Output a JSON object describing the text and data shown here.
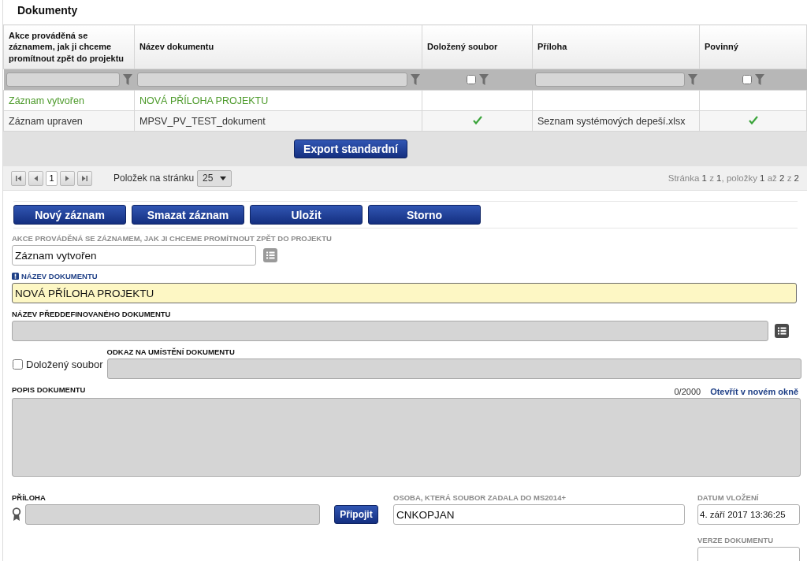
{
  "section_title": "Dokumenty",
  "table": {
    "columns": [
      "Akce prováděná se záznamem, jak ji chceme promítnout zpět do projektu",
      "Název dokumentu",
      "Doložený soubor",
      "Příloha",
      "Povinný"
    ],
    "filters": [
      {
        "kind": "text"
      },
      {
        "kind": "text"
      },
      {
        "kind": "checkbox",
        "checked": false
      },
      {
        "kind": "text"
      },
      {
        "kind": "checkbox",
        "checked": false
      }
    ],
    "rows": [
      {
        "new": true,
        "cells": [
          {
            "kind": "text",
            "text": "Záznam vytvořen"
          },
          {
            "kind": "text",
            "text": "NOVÁ PŘÍLOHA PROJEKTU"
          },
          {
            "kind": "check",
            "checked": false
          },
          {
            "kind": "text",
            "text": ""
          },
          {
            "kind": "check",
            "checked": false
          }
        ]
      },
      {
        "new": false,
        "cells": [
          {
            "kind": "text",
            "text": "Záznam upraven"
          },
          {
            "kind": "text",
            "text": "MPSV_PV_TEST_dokument"
          },
          {
            "kind": "check",
            "checked": true
          },
          {
            "kind": "text",
            "text": "Seznam systémových depeší.xlsx"
          },
          {
            "kind": "check",
            "checked": true
          }
        ]
      }
    ]
  },
  "export_button": "Export standardní",
  "pager": {
    "page": "1",
    "page_size_label": "Položek na stránku",
    "page_size": "25",
    "summary": "Stránka **1** z **1**, položky **1** až **2** z **2**"
  },
  "actions": [
    "Nový záznam",
    "Smazat záznam",
    "Uložit",
    "Storno"
  ],
  "form": {
    "action": {
      "label": "AKCE PROVÁDĚNÁ SE ZÁZNAMEM, JAK JI CHCEME PROMÍTNOUT ZPĚT DO PROJEKTU",
      "value": "Záznam vytvořen",
      "disabled": false
    },
    "name": {
      "label": "NÁZEV DOKUMENTU",
      "value": "NOVÁ PŘÍLOHA PROJEKTU",
      "required": true
    },
    "predefined": {
      "label": "NÁZEV PŘEDDEFINOVANÉHO DOKUMENTU",
      "disabled": true
    },
    "provided_file": {
      "label": "Doložený soubor",
      "checked": false
    },
    "location": {
      "label": "ODKAZ NA UMÍSTĚNÍ DOKUMENTU",
      "disabled": true
    },
    "description": {
      "label": "POPIS DOKUMENTU",
      "counter": "0/2000",
      "link": "Otevřít v novém okně",
      "disabled": true
    },
    "attachment": {
      "label": "PŘÍLOHA",
      "button": "Připojit",
      "disabled": true
    },
    "person": {
      "label": "OSOBA, KTERÁ SOUBOR ZADALA DO MS2014+",
      "value": "CNKOPJAN",
      "disabled": false
    },
    "inserted": {
      "label": "DATUM VLOŽENÍ",
      "value": "4. září 2017 13:36:25",
      "disabled": false
    },
    "version": {
      "label": "VERZE DOKUMENTU",
      "disabled": false
    }
  }
}
